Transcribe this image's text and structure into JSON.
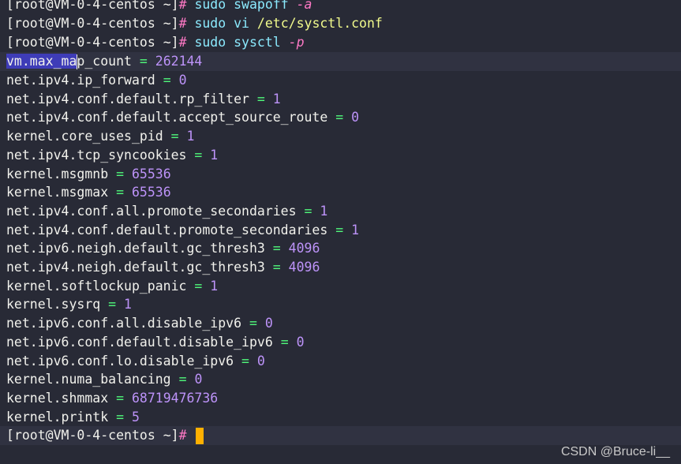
{
  "prompt": {
    "user_host": "root@VM-0-4-centos",
    "cwd": "~",
    "symbol": "#"
  },
  "commands": [
    {
      "cmd": "sudo swapoff",
      "arg": "-a"
    },
    {
      "cmd": "sudo vi",
      "arg": "/etc/sysctl.conf"
    },
    {
      "cmd": "sudo sysctl",
      "arg": "-p"
    }
  ],
  "selected_text": "vm.max_ma",
  "output": [
    {
      "key": "vm.max_map_count",
      "value": "262144"
    },
    {
      "key": "net.ipv4.ip_forward",
      "value": "0"
    },
    {
      "key": "net.ipv4.conf.default.rp_filter",
      "value": "1"
    },
    {
      "key": "net.ipv4.conf.default.accept_source_route",
      "value": "0"
    },
    {
      "key": "kernel.core_uses_pid",
      "value": "1"
    },
    {
      "key": "net.ipv4.tcp_syncookies",
      "value": "1"
    },
    {
      "key": "kernel.msgmnb",
      "value": "65536"
    },
    {
      "key": "kernel.msgmax",
      "value": "65536"
    },
    {
      "key": "net.ipv4.conf.all.promote_secondaries",
      "value": "1"
    },
    {
      "key": "net.ipv4.conf.default.promote_secondaries",
      "value": "1"
    },
    {
      "key": "net.ipv6.neigh.default.gc_thresh3",
      "value": "4096"
    },
    {
      "key": "net.ipv4.neigh.default.gc_thresh3",
      "value": "4096"
    },
    {
      "key": "kernel.softlockup_panic",
      "value": "1"
    },
    {
      "key": "kernel.sysrq",
      "value": "1"
    },
    {
      "key": "net.ipv6.conf.all.disable_ipv6",
      "value": "0"
    },
    {
      "key": "net.ipv6.conf.default.disable_ipv6",
      "value": "0"
    },
    {
      "key": "net.ipv6.conf.lo.disable_ipv6",
      "value": "0"
    },
    {
      "key": "kernel.numa_balancing",
      "value": "0"
    },
    {
      "key": "kernel.shmmax",
      "value": "68719476736"
    },
    {
      "key": "kernel.printk",
      "value": "5"
    }
  ],
  "watermark": "CSDN @Bruce-li__",
  "colors": {
    "background": "#282a36",
    "foreground": "#f1f1ec",
    "command": "#8be9fd",
    "path": "#f1fa8c",
    "flag": "#ff79c6",
    "equals": "#50fa7b",
    "number": "#bd93f9",
    "cursor": "#ffb000",
    "selection": "#3e3cb8"
  }
}
